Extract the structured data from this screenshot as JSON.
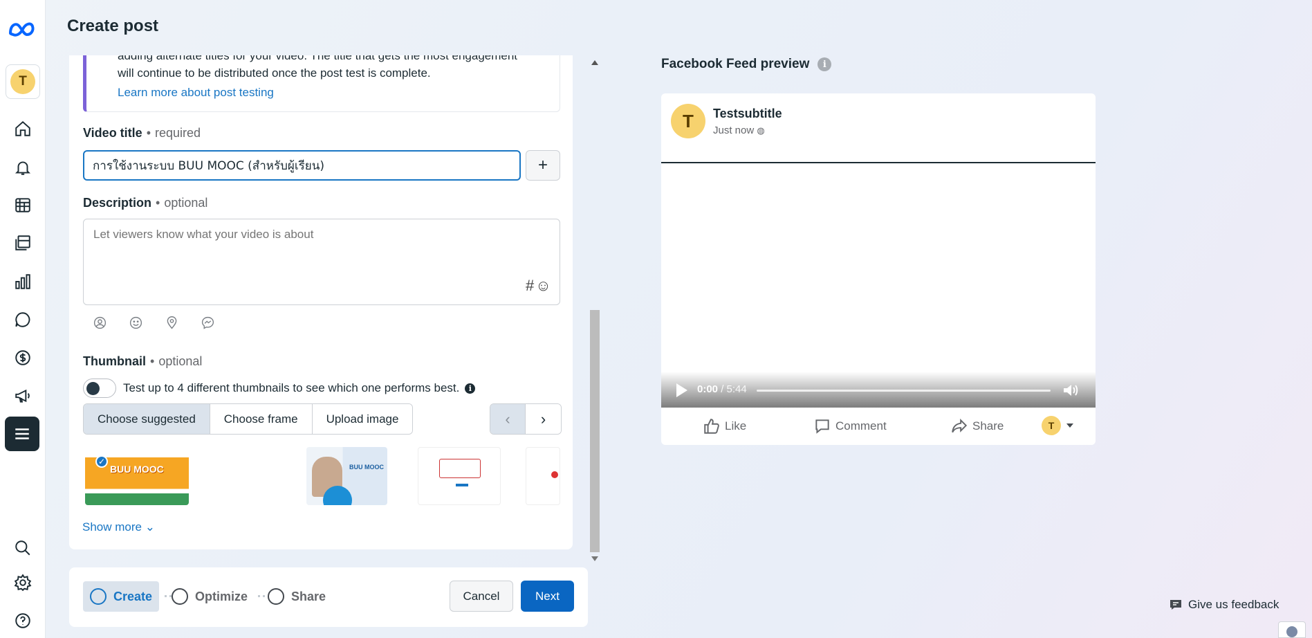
{
  "header": {
    "title": "Create post"
  },
  "rail": {
    "avatar_initial": "T",
    "icons": [
      "meta-logo-icon",
      "home-icon",
      "notifications-icon",
      "calendar-icon",
      "content-icon",
      "insights-icon",
      "inbox-icon",
      "monetization-icon",
      "ads-icon",
      "menu-icon",
      "search-icon",
      "settings-icon",
      "help-icon"
    ]
  },
  "info_box": {
    "partial_text": "adding alternate titles for your video. The title that gets the most engagement",
    "text": "will continue to be distributed once the post test is complete.",
    "link": "Learn more about post testing"
  },
  "video_title": {
    "label": "Video title",
    "qualifier": "required",
    "value": "การใช้งานระบบ BUU MOOC (สำหรับผู้เรียน)"
  },
  "description": {
    "label": "Description",
    "qualifier": "optional",
    "placeholder": "Let viewers know what your video is about",
    "tools": "#☺"
  },
  "thumbnail": {
    "label": "Thumbnail",
    "qualifier": "optional",
    "toggle_text": "Test up to 4 different thumbnails to see which one performs best.",
    "toggle_on": false,
    "tabs": [
      "Choose suggested",
      "Choose frame",
      "Upload image"
    ],
    "active_tab": "Choose suggested",
    "thumb_brand": "BUU MOOC",
    "thumb2_label": "BUU MOOC",
    "show_more": "Show more"
  },
  "steps": {
    "items": [
      "Create",
      "Optimize",
      "Share"
    ],
    "active": "Create",
    "cancel": "Cancel",
    "next": "Next"
  },
  "preview": {
    "heading": "Facebook Feed preview",
    "page_name": "Testsubtitle",
    "time": "Just now",
    "video_current": "0:00",
    "video_total": "/ 5:44",
    "actions": [
      "Like",
      "Comment",
      "Share"
    ]
  },
  "feedback": "Give us feedback",
  "colors": {
    "primary": "#0a66c2",
    "link": "#1976c4",
    "accent_bar": "#7c62d8",
    "avatar": "#f7d26e"
  }
}
